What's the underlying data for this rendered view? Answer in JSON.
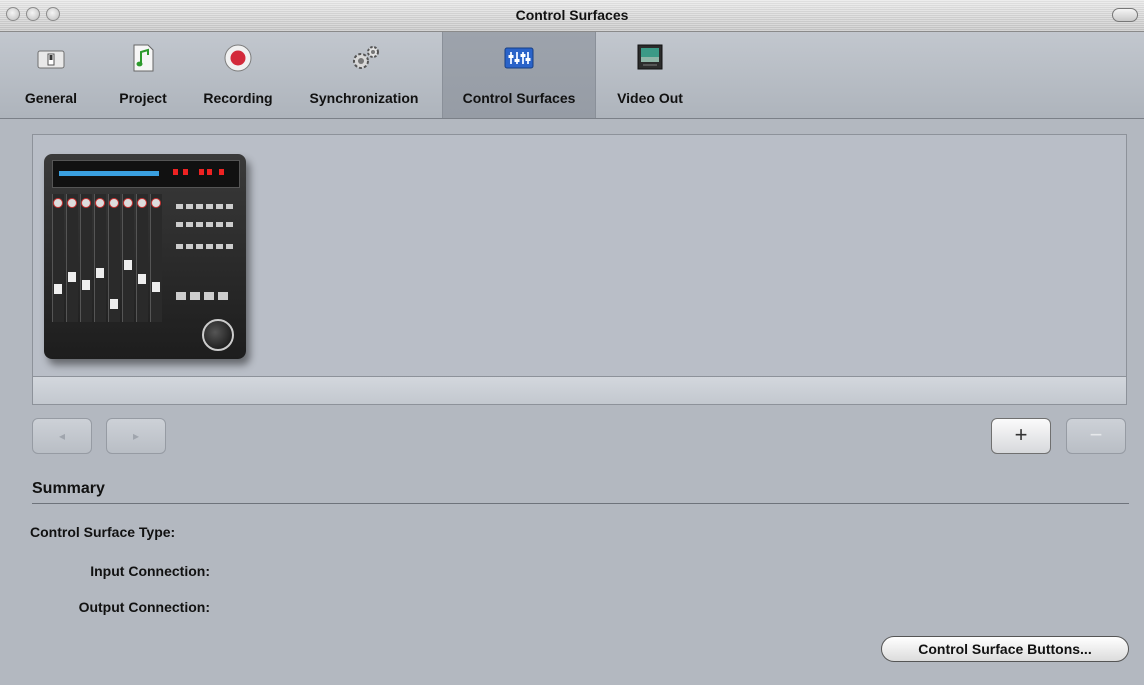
{
  "window": {
    "title": "Control Surfaces"
  },
  "toolbar": {
    "items": [
      {
        "label": "General",
        "icon": "general-switch-icon"
      },
      {
        "label": "Project",
        "icon": "project-note-icon"
      },
      {
        "label": "Recording",
        "icon": "record-icon"
      },
      {
        "label": "Synchronization",
        "icon": "gears-icon"
      },
      {
        "label": "Control Surfaces",
        "icon": "control-surface-icon",
        "selected": true
      },
      {
        "label": "Video Out",
        "icon": "video-monitor-icon"
      }
    ]
  },
  "nav": {
    "prev_glyph": "◂",
    "next_glyph": "▸"
  },
  "actions": {
    "add_glyph": "+",
    "remove_glyph": "−"
  },
  "summary": {
    "title": "Summary",
    "type_label": "Control Surface Type:",
    "input_label": "Input Connection:",
    "output_label": "Output Connection:"
  },
  "buttons": {
    "control_surface_buttons": "Control Surface Buttons..."
  },
  "colors": {
    "selected_tab": "#9da3ac",
    "panel_bg": "#b3b8c0",
    "record_red": "#d3293a",
    "cs_icon_blue": "#2a63c9"
  }
}
